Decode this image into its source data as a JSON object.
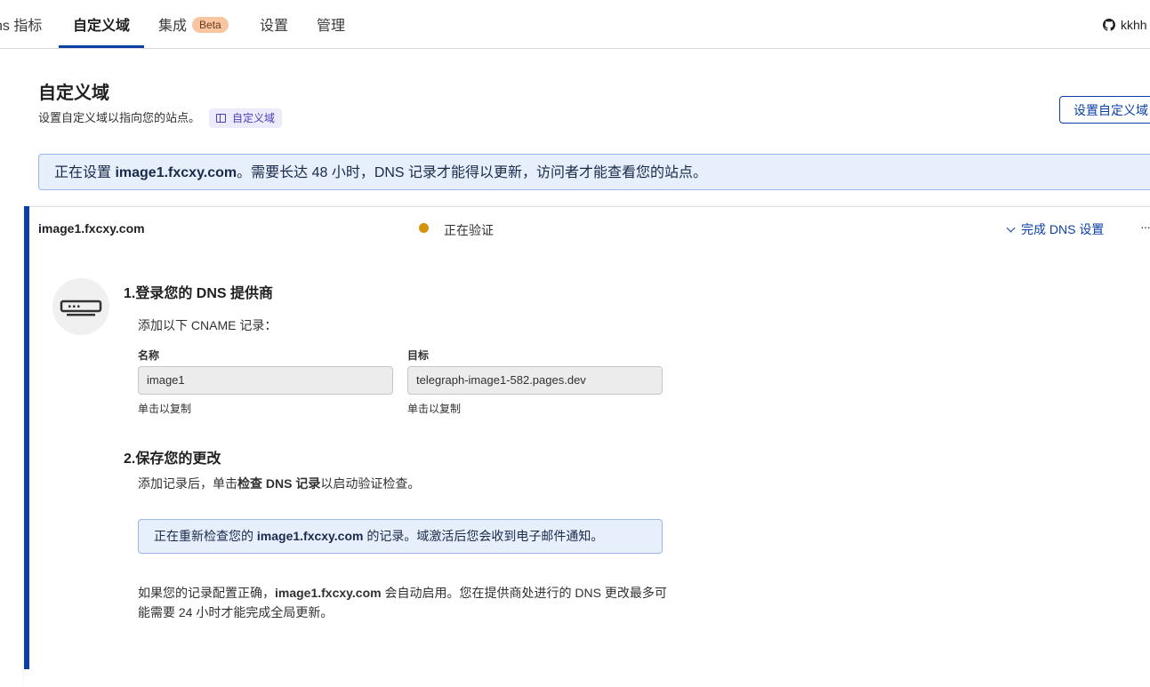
{
  "nav": {
    "tabs": [
      {
        "label": "ns 指标"
      },
      {
        "label": "自定义域"
      },
      {
        "label": "集成",
        "badge": "Beta"
      },
      {
        "label": "设置"
      },
      {
        "label": "管理"
      }
    ],
    "active_tab": "自定义域",
    "user": "kkhh",
    "user_icon": "github-icon"
  },
  "header": {
    "title": "自定义域",
    "subtitle": "设置自定义域以指向您的站点。",
    "doc_link": "自定义域",
    "setup_button": "设置自定义域"
  },
  "banner": {
    "prefix": "正在设置 ",
    "domain": "image1.fxcxy.com",
    "suffix": "。需要长达 48 小时，DNS 记录才能得以更新，访问者才能查看您的站点。"
  },
  "card": {
    "domain": "image1.fxcxy.com",
    "status": "正在验证",
    "status_color": "#d4920e",
    "finish_link": "完成 DNS 设置",
    "more_menu": "···",
    "step1": {
      "title": "1.登录您的 DNS 提供商",
      "instruction": "添加以下 CNAME 记录：",
      "name_label": "名称",
      "name_value": "image1",
      "name_hint": "单击以复制",
      "target_label": "目标",
      "target_value": "telegraph-image1-582.pages.dev",
      "target_hint": "单击以复制"
    },
    "step2": {
      "title": "2.保存您的更改",
      "text_prefix": "添加记录后，单击",
      "text_bold": "检查 DNS 记录",
      "text_suffix": "以启动验证检查。"
    },
    "recheck": {
      "prefix": "正在重新检查您的 ",
      "domain": "image1.fxcxy.com",
      "suffix": " 的记录。域激活后您会收到电子邮件通知。"
    },
    "note": {
      "prefix": "如果您的记录配置正确，",
      "domain": "image1.fxcxy.com",
      "suffix": " 会自动启用。您在提供商处进行的 DNS 更改最多可能需要 24 小时才能完成全局更新。"
    }
  },
  "colors": {
    "accent": "#0b3fa8",
    "info_bg": "#e6effb",
    "beta_bg": "#f7c59f"
  }
}
